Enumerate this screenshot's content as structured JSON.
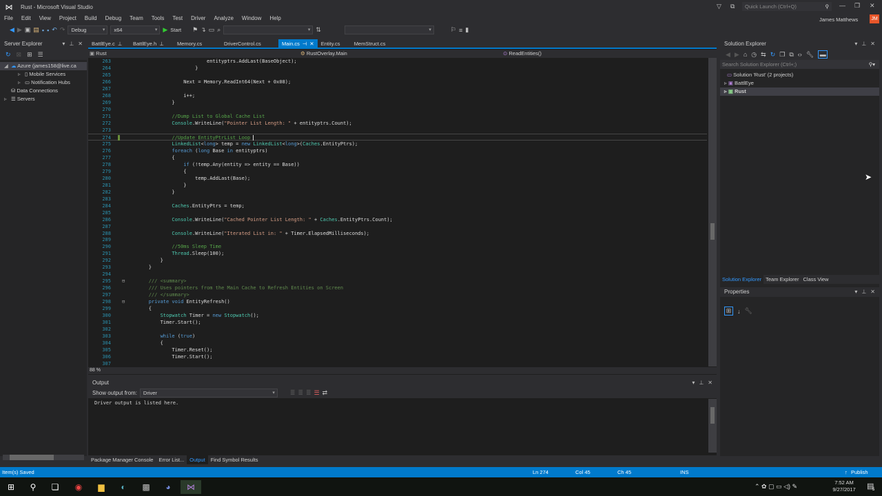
{
  "window": {
    "title": "Rust - Microsoft Visual Studio",
    "quick_launch_placeholder": "Quick Launch (Ctrl+Q)",
    "user": "James Matthews",
    "user_initials": "JM"
  },
  "menu": [
    "File",
    "Edit",
    "View",
    "Project",
    "Build",
    "Debug",
    "Team",
    "Tools",
    "Test",
    "Driver",
    "Analyze",
    "Window",
    "Help"
  ],
  "toolbar": {
    "config": "Debug",
    "platform": "x64",
    "start": "Start"
  },
  "server_explorer": {
    "title": "Server Explorer",
    "items": [
      {
        "label": "Azure (james158@live.ca",
        "level": 0,
        "expanded": true,
        "icon": "cloud-icon"
      },
      {
        "label": "Mobile Services",
        "level": 1,
        "icon": "phone-icon"
      },
      {
        "label": "Notification Hubs",
        "level": 1,
        "icon": "bubble-icon"
      },
      {
        "label": "Data Connections",
        "level": 0,
        "icon": "db-icon"
      },
      {
        "label": "Servers",
        "level": 0,
        "icon": "server-icon"
      }
    ]
  },
  "tabs": [
    {
      "label": "BattlEye.c",
      "pinned": true
    },
    {
      "label": "BattlEye.h",
      "pinned": true
    },
    {
      "label": "Memory.cs"
    },
    {
      "label": "DriverControl.cs"
    },
    {
      "label": "Main.cs",
      "active": true
    },
    {
      "label": "Entity.cs"
    },
    {
      "label": "MemStruct.cs"
    }
  ],
  "navbar": {
    "project": "Rust",
    "class": "RustOverlay.Main",
    "member": "ReadEntities()"
  },
  "code": [
    {
      "n": "263",
      "t": [
        [
          "p",
          "                            entityptrs.AddLast(BaseObject);"
        ]
      ]
    },
    {
      "n": "264",
      "t": [
        [
          "p",
          "                        }"
        ]
      ]
    },
    {
      "n": "265",
      "t": []
    },
    {
      "n": "266",
      "t": [
        [
          "p",
          "                    Next = Memory.ReadInt64(Next + 0x08);"
        ]
      ]
    },
    {
      "n": "267",
      "t": []
    },
    {
      "n": "268",
      "t": [
        [
          "p",
          "                    i++;"
        ]
      ]
    },
    {
      "n": "269",
      "t": [
        [
          "p",
          "                }"
        ]
      ]
    },
    {
      "n": "270",
      "t": []
    },
    {
      "n": "271",
      "t": [
        [
          "c",
          "                //Dump List to Global Cache List"
        ]
      ]
    },
    {
      "n": "272",
      "t": [
        [
          "t",
          "                Console"
        ],
        [
          "p",
          ".WriteLine("
        ],
        [
          "s",
          "\"Pointer List Length: \""
        ],
        [
          "p",
          " + entityptrs.Count);"
        ]
      ]
    },
    {
      "n": "273",
      "t": []
    },
    {
      "n": "274",
      "t": [
        [
          "c",
          "                //Update EntityPtrList Loop "
        ]
      ],
      "current": true
    },
    {
      "n": "275",
      "t": [
        [
          "t",
          "                LinkedList"
        ],
        [
          "p",
          "<"
        ],
        [
          "k",
          "long"
        ],
        [
          "p",
          "> temp = "
        ],
        [
          "k",
          "new "
        ],
        [
          "t",
          "LinkedList"
        ],
        [
          "p",
          "<"
        ],
        [
          "k",
          "long"
        ],
        [
          "p",
          ">("
        ],
        [
          "t",
          "Caches"
        ],
        [
          "p",
          ".EntityPtrs);"
        ]
      ]
    },
    {
      "n": "276",
      "t": [
        [
          "k",
          "                foreach"
        ],
        [
          "p",
          " ("
        ],
        [
          "k",
          "long"
        ],
        [
          "p",
          " Base "
        ],
        [
          "k",
          "in"
        ],
        [
          "p",
          " entityptrs)"
        ]
      ]
    },
    {
      "n": "277",
      "t": [
        [
          "p",
          "                {"
        ]
      ]
    },
    {
      "n": "278",
      "t": [
        [
          "k",
          "                    if"
        ],
        [
          "p",
          " (!temp.Any(entity => entity == Base))"
        ]
      ]
    },
    {
      "n": "279",
      "t": [
        [
          "p",
          "                    {"
        ]
      ]
    },
    {
      "n": "280",
      "t": [
        [
          "p",
          "                        temp.AddLast(Base);"
        ]
      ]
    },
    {
      "n": "281",
      "t": [
        [
          "p",
          "                    }"
        ]
      ]
    },
    {
      "n": "282",
      "t": [
        [
          "p",
          "                }"
        ]
      ]
    },
    {
      "n": "283",
      "t": []
    },
    {
      "n": "284",
      "t": [
        [
          "t",
          "                Caches"
        ],
        [
          "p",
          ".EntityPtrs = temp;"
        ]
      ]
    },
    {
      "n": "285",
      "t": []
    },
    {
      "n": "286",
      "t": [
        [
          "t",
          "                Console"
        ],
        [
          "p",
          ".WriteLine("
        ],
        [
          "s",
          "\"Cached Pointer List Length: \""
        ],
        [
          "p",
          " + "
        ],
        [
          "t",
          "Caches"
        ],
        [
          "p",
          ".EntityPtrs.Count);"
        ]
      ]
    },
    {
      "n": "287",
      "t": []
    },
    {
      "n": "288",
      "t": [
        [
          "t",
          "                Console"
        ],
        [
          "p",
          ".WriteLine("
        ],
        [
          "s",
          "\"Iterated List in: \""
        ],
        [
          "p",
          " + Timer.ElapsedMilliseconds);"
        ]
      ]
    },
    {
      "n": "289",
      "t": []
    },
    {
      "n": "290",
      "t": [
        [
          "c",
          "                //50ms Sleep Time"
        ]
      ]
    },
    {
      "n": "291",
      "t": [
        [
          "t",
          "                Thread"
        ],
        [
          "p",
          ".Sleep(100);"
        ]
      ]
    },
    {
      "n": "292",
      "t": [
        [
          "p",
          "            }"
        ]
      ]
    },
    {
      "n": "293",
      "t": [
        [
          "p",
          "        }"
        ]
      ]
    },
    {
      "n": "294",
      "t": []
    },
    {
      "n": "295",
      "t": [
        [
          "x",
          "        /// <summary>"
        ]
      ]
    },
    {
      "n": "296",
      "t": [
        [
          "x",
          "        /// Uses pointers from the Main Cache to Refresh Entities on Screen"
        ]
      ]
    },
    {
      "n": "297",
      "t": [
        [
          "x",
          "        /// </summary>"
        ]
      ]
    },
    {
      "n": "298",
      "t": [
        [
          "k",
          "        private void "
        ],
        [
          "p",
          "EntityRefresh()"
        ]
      ]
    },
    {
      "n": "299",
      "t": [
        [
          "p",
          "        {"
        ]
      ]
    },
    {
      "n": "300",
      "t": [
        [
          "t",
          "            Stopwatch"
        ],
        [
          "p",
          " Timer = "
        ],
        [
          "k",
          "new "
        ],
        [
          "t",
          "Stopwatch"
        ],
        [
          "p",
          "();"
        ]
      ]
    },
    {
      "n": "301",
      "t": [
        [
          "p",
          "            Timer.Start();"
        ]
      ]
    },
    {
      "n": "302",
      "t": []
    },
    {
      "n": "303",
      "t": [
        [
          "k",
          "            while"
        ],
        [
          "p",
          " ("
        ],
        [
          "k",
          "true"
        ],
        [
          "p",
          ")"
        ]
      ]
    },
    {
      "n": "304",
      "t": [
        [
          "p",
          "            {"
        ]
      ]
    },
    {
      "n": "305",
      "t": [
        [
          "p",
          "                Timer.Reset();"
        ]
      ]
    },
    {
      "n": "306",
      "t": [
        [
          "p",
          "                Timer.Start();"
        ]
      ]
    },
    {
      "n": "307",
      "t": []
    }
  ],
  "editor": {
    "zoom": "88 %"
  },
  "output": {
    "title": "Output",
    "show_from_label": "Show output from:",
    "source": "Driver",
    "text": "Driver output is listed here."
  },
  "bottom_tabs": [
    "Package Manager Console",
    "Error List...",
    "Output",
    "Find Symbol Results"
  ],
  "solution_explorer": {
    "title": "Solution Explorer",
    "search_placeholder": "Search Solution Explorer (Ctrl+;)",
    "solution": "Solution 'Rust' (2 projects)",
    "projects": [
      "BattlEye",
      "Rust"
    ]
  },
  "right_tabs": [
    "Solution Explorer",
    "Team Explorer",
    "Class View"
  ],
  "properties": {
    "title": "Properties"
  },
  "status": {
    "message": "Item(s) Saved",
    "ln": "Ln 274",
    "col": "Col 45",
    "ch": "Ch 45",
    "mode": "INS",
    "publish": "Publish"
  },
  "taskbar": {
    "time": "7:52 AM",
    "date": "9/27/2017",
    "notifications": "5"
  },
  "colors": {
    "accent": "#007acc",
    "editor_bg": "#1e1e1e",
    "chrome": "#2d2d30",
    "keyword": "#569cd6",
    "type": "#4ec9b0",
    "string": "#d69d85",
    "comment": "#57a64a"
  }
}
